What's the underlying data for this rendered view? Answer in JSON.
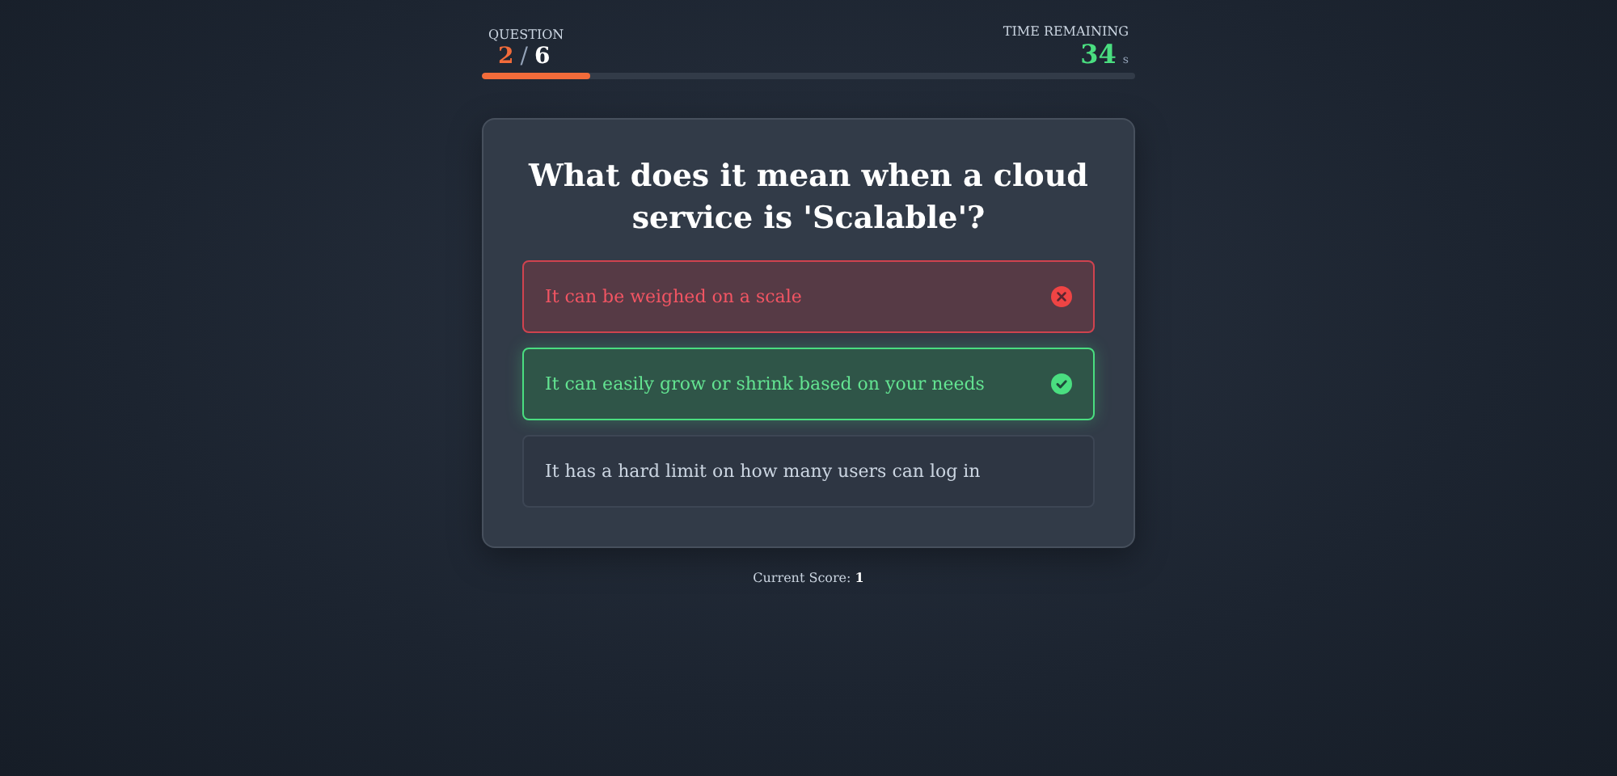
{
  "progress": {
    "label": "QUESTION",
    "current": "2",
    "separator": "/",
    "total": "6",
    "level": 0.167
  },
  "timer": {
    "label": "TIME REMAINING",
    "value": "34",
    "unit": "s"
  },
  "question": "What does it mean when a cloud service is 'Scalable'?",
  "options": [
    {
      "text": "It can be weighed on a scale",
      "kind": "wrong"
    },
    {
      "text": "It can easily grow or shrink based on your needs",
      "kind": "correct"
    },
    {
      "text": "It has a hard limit on how many users can log in",
      "kind": "neutral"
    }
  ],
  "score": "Current Score: **1**"
}
